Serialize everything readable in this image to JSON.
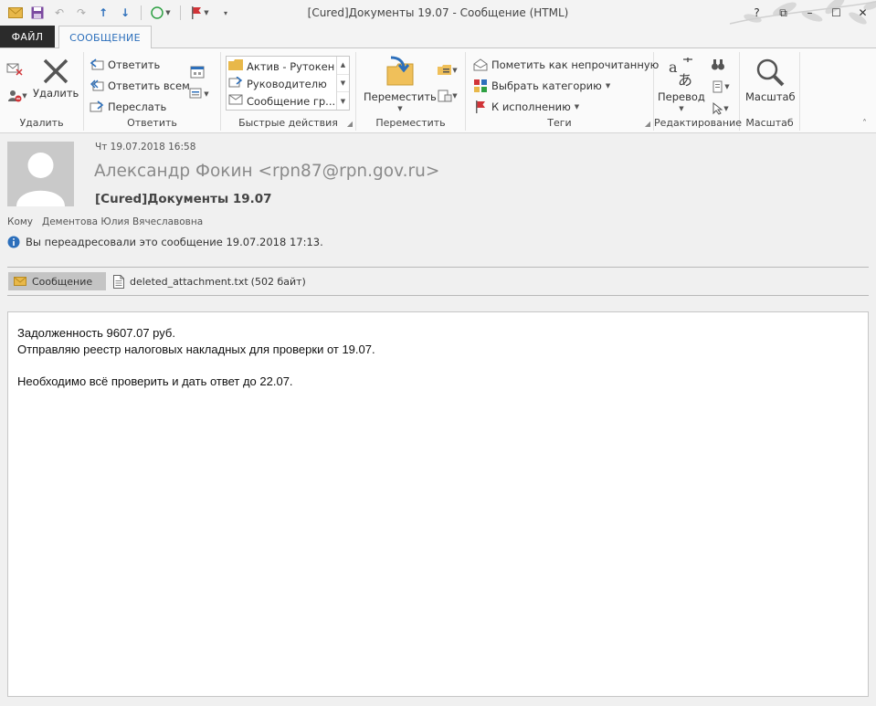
{
  "window": {
    "title": "[Cured]Документы 19.07 - Сообщение (HTML)",
    "controls": [
      "?",
      "⧉",
      "–",
      "☐",
      "✕"
    ]
  },
  "tabs": [
    {
      "label": "ФАЙЛ"
    },
    {
      "label": "СООБЩЕНИЕ"
    }
  ],
  "ribbon": {
    "delete": {
      "delete_label": "Удалить",
      "group_label": "Удалить"
    },
    "respond": {
      "reply": "Ответить",
      "reply_all": "Ответить всем",
      "forward": "Переслать",
      "group_label": "Ответить"
    },
    "quick_steps": {
      "items": [
        "Актив - Рутокен",
        "Руководителю",
        "Сообщение гр..."
      ],
      "group_label": "Быстрые действия"
    },
    "move": {
      "move_label": "Переместить",
      "group_label": "Переместить"
    },
    "tags": {
      "mark_unread": "Пометить как непрочитанную",
      "categorize": "Выбрать категорию",
      "follow_up": "К исполнению",
      "group_label": "Теги"
    },
    "editing": {
      "translate": "Перевод",
      "group_label": "Редактирование"
    },
    "zoom": {
      "zoom_label": "Масштаб",
      "group_label": "Масштаб"
    }
  },
  "message": {
    "date": "Чт 19.07.2018 16:58",
    "sender": "Александр Фокин <rpn87@rpn.gov.ru>",
    "subject": "[Cured]Документы 19.07",
    "to_label": "Кому",
    "to_name": "Дементова Юлия Вячеславовна",
    "info": "Вы переадресовали это сообщение 19.07.2018 17:13.",
    "attachments": {
      "message_tab": "Сообщение",
      "file_name": "deleted_attachment.txt",
      "file_size": "(502 байт)"
    },
    "body_lines": [
      "Задолженность 9607.07 руб.",
      "Отправляю реестр налоговых накладных для проверки от 19.07.",
      "",
      "Необходимо всё проверить и дать ответ до 22.07."
    ]
  },
  "colors": {
    "accent": "#2c6fbb",
    "file_tab": "#2b2b2b",
    "flag": "#d13438"
  }
}
